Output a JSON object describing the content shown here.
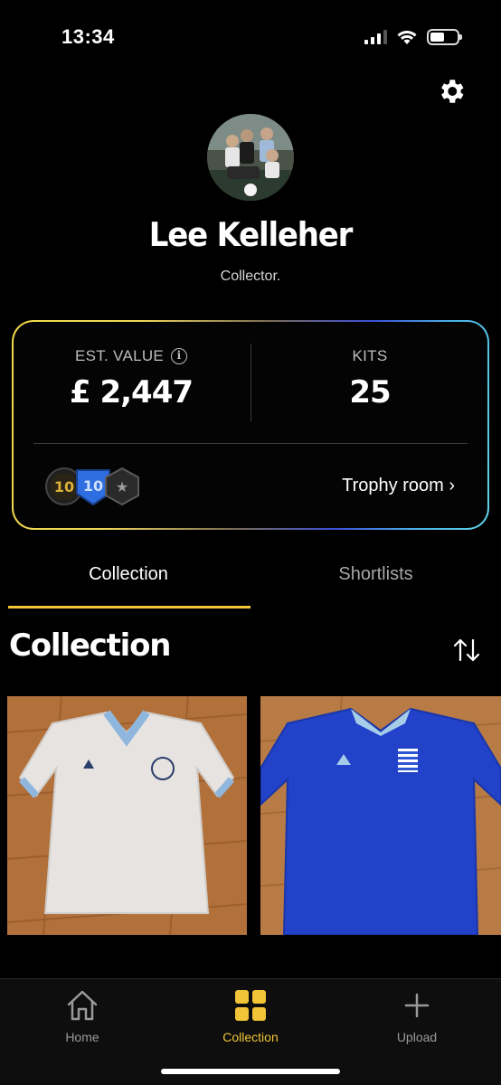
{
  "status_bar": {
    "time": "13:34",
    "battery_level": 0.55
  },
  "header": {
    "settings_icon": "gear-icon"
  },
  "profile": {
    "avatar_icon": "profile-photo",
    "name": "Lee Kelleher",
    "tagline": "Collector."
  },
  "stats": {
    "est_value_label": "EST. VALUE",
    "est_value": "£ 2,447",
    "info_icon": "i",
    "kits_label": "KITS",
    "kits_value": "25",
    "badges": [
      {
        "icon": "gold-10-badge",
        "text": "10",
        "color": "#d9b13a"
      },
      {
        "icon": "blue-10-badge",
        "text": "10",
        "color": "#2f6ee0"
      },
      {
        "icon": "star-hex-badge",
        "text": "★",
        "color": "#6a6a6a"
      }
    ],
    "trophy_link": "Trophy room ›"
  },
  "tabs": [
    {
      "label": "Collection",
      "active": true
    },
    {
      "label": "Shortlists",
      "active": false
    }
  ],
  "section": {
    "title": "Collection",
    "sort_icon": "sort-arrows-icon"
  },
  "kits": [
    {
      "description_icon": "white-shirt-photo"
    },
    {
      "description_icon": "blue-shirt-photo"
    }
  ],
  "nav": [
    {
      "label": "Home",
      "icon": "home-icon"
    },
    {
      "label": "Collection",
      "icon": "grid-icon",
      "active": true
    },
    {
      "label": "Upload",
      "icon": "plus-icon"
    }
  ],
  "colors": {
    "accent": "#f2c437",
    "background": "#000000"
  }
}
